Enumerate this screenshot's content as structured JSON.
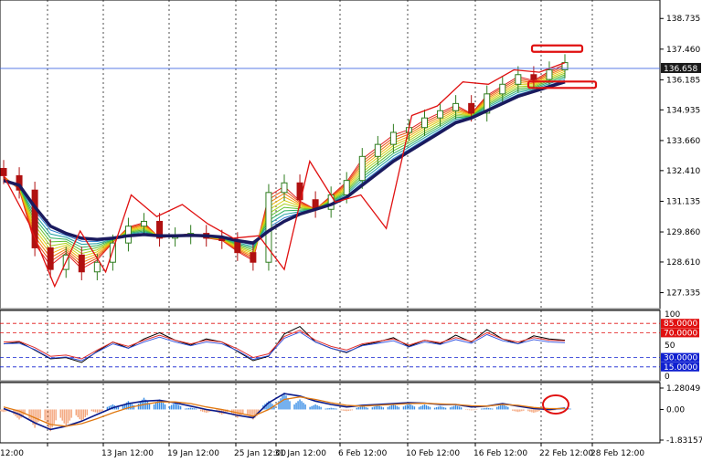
{
  "chart_data": [
    {
      "type": "line",
      "panel": "price",
      "y_ticks": [
        "138.735",
        "137.460",
        "136.185",
        "134.935",
        "133.660",
        "132.410",
        "131.135",
        "129.860",
        "128.610",
        "127.335"
      ],
      "current_price": "136.658",
      "ylim": [
        126.9,
        139.2
      ],
      "close": [
        132.2,
        131.6,
        129.2,
        128.3,
        128.9,
        128.2,
        128.6,
        129.4,
        130.1,
        130.3,
        129.6,
        129.7,
        129.8,
        129.6,
        129.5,
        129.0,
        128.6,
        131.5,
        131.9,
        131.2,
        130.8,
        131.4,
        132.0,
        133.0,
        133.5,
        134.0,
        134.2,
        134.6,
        134.9,
        135.2,
        134.8,
        135.6,
        136.0,
        136.4,
        136.2,
        136.6,
        136.9
      ],
      "ema_slow": [
        132.0,
        131.8,
        130.9,
        130.1,
        129.8,
        129.6,
        129.55,
        129.6,
        129.7,
        129.75,
        129.7,
        129.7,
        129.72,
        129.7,
        129.65,
        129.5,
        129.4,
        129.9,
        130.3,
        130.6,
        130.8,
        131.0,
        131.3,
        131.8,
        132.3,
        132.8,
        133.2,
        133.6,
        134.0,
        134.4,
        134.6,
        134.9,
        135.2,
        135.5,
        135.7,
        135.9,
        136.1
      ],
      "zigzag": [
        132.2,
        130.2,
        127.6,
        129.9,
        128.2,
        131.4,
        130.5,
        131.0,
        130.2,
        129.6,
        129.7,
        128.3,
        132.8,
        131.1,
        131.4,
        130.0,
        134.7,
        135.1,
        136.1,
        136.0,
        136.6,
        136.5,
        136.9
      ],
      "levels": [
        "137.5",
        "136.0"
      ]
    },
    {
      "type": "line",
      "panel": "oscillator",
      "y_ticks": [
        "100",
        "50",
        "0"
      ],
      "levels": [
        "85.0000",
        "70.0000",
        "30.0000",
        "15.0000"
      ],
      "ylim": [
        0,
        100
      ],
      "series": [
        {
          "values": [
            52,
            55,
            42,
            28,
            30,
            22,
            40,
            55,
            45,
            60,
            70,
            58,
            50,
            60,
            55,
            40,
            25,
            32,
            68,
            80,
            55,
            45,
            38,
            50,
            55,
            62,
            48,
            58,
            52,
            66,
            55,
            75,
            60,
            52,
            65,
            60,
            58
          ]
        },
        {
          "values": [
            55,
            56,
            46,
            32,
            34,
            28,
            42,
            55,
            48,
            58,
            66,
            58,
            52,
            58,
            55,
            44,
            30,
            36,
            64,
            74,
            58,
            48,
            42,
            52,
            56,
            60,
            50,
            58,
            54,
            62,
            56,
            70,
            60,
            55,
            62,
            58,
            57
          ]
        }
      ]
    },
    {
      "type": "bar",
      "panel": "macd",
      "y_ticks": [
        "1.28049",
        "0.00",
        "-1.83157"
      ],
      "ylim": [
        -1.83157,
        1.28049
      ],
      "histogram": [
        -0.15,
        -0.6,
        -1.1,
        -1.3,
        -1.0,
        -0.7,
        -0.2,
        0.3,
        0.5,
        0.7,
        0.6,
        0.4,
        0.1,
        -0.2,
        -0.3,
        -0.5,
        -0.6,
        0.5,
        1.0,
        0.6,
        0.3,
        0.1,
        -0.1,
        0.2,
        0.25,
        0.3,
        0.35,
        0.3,
        0.2,
        0.25,
        -0.05,
        0.1,
        0.3,
        -0.15,
        -0.2,
        -0.1,
        0.1
      ],
      "macd": [
        0.05,
        -0.3,
        -0.8,
        -1.2,
        -1.0,
        -0.7,
        -0.3,
        0.1,
        0.35,
        0.5,
        0.55,
        0.4,
        0.2,
        0.0,
        -0.15,
        -0.35,
        -0.5,
        0.4,
        0.95,
        0.8,
        0.5,
        0.3,
        0.15,
        0.25,
        0.3,
        0.35,
        0.4,
        0.38,
        0.3,
        0.3,
        0.15,
        0.2,
        0.35,
        0.2,
        0.05,
        0.0,
        0.08
      ],
      "signal": [
        0.15,
        -0.1,
        -0.5,
        -0.9,
        -1.0,
        -0.85,
        -0.55,
        -0.2,
        0.1,
        0.3,
        0.45,
        0.45,
        0.35,
        0.15,
        0.0,
        -0.2,
        -0.4,
        0.0,
        0.6,
        0.75,
        0.6,
        0.4,
        0.25,
        0.2,
        0.25,
        0.3,
        0.35,
        0.37,
        0.33,
        0.3,
        0.22,
        0.2,
        0.3,
        0.25,
        0.12,
        0.05,
        0.05
      ]
    }
  ],
  "x_axis": {
    "labels": [
      "12:00",
      "13 Jan 12:00",
      "19 Jan 12:00",
      "25 Jan 12:00",
      "31 Jan 12:00",
      "6 Feb 12:00",
      "10 Feb 12:00",
      "16 Feb 12:00",
      "22 Feb 12:00",
      "28 Feb 12:00"
    ]
  },
  "colors": {
    "grid": "#000000",
    "slow_ma": "#1a1a5e",
    "zigzag": "#e01010",
    "bull_candle": "#2f7d1f",
    "bear_candle": "#b01010",
    "price_line": "#4169e1",
    "osc_main": "#000000",
    "osc_rsi": "#e03030",
    "osc_blue": "#3050e0",
    "hist_pos": "#3a8ee6",
    "hist_neg": "#f4a47a",
    "macd_line": "#0a1a8a",
    "signal_line": "#e07810",
    "badge_red": "#e01010",
    "badge_blue": "#1020d0"
  }
}
